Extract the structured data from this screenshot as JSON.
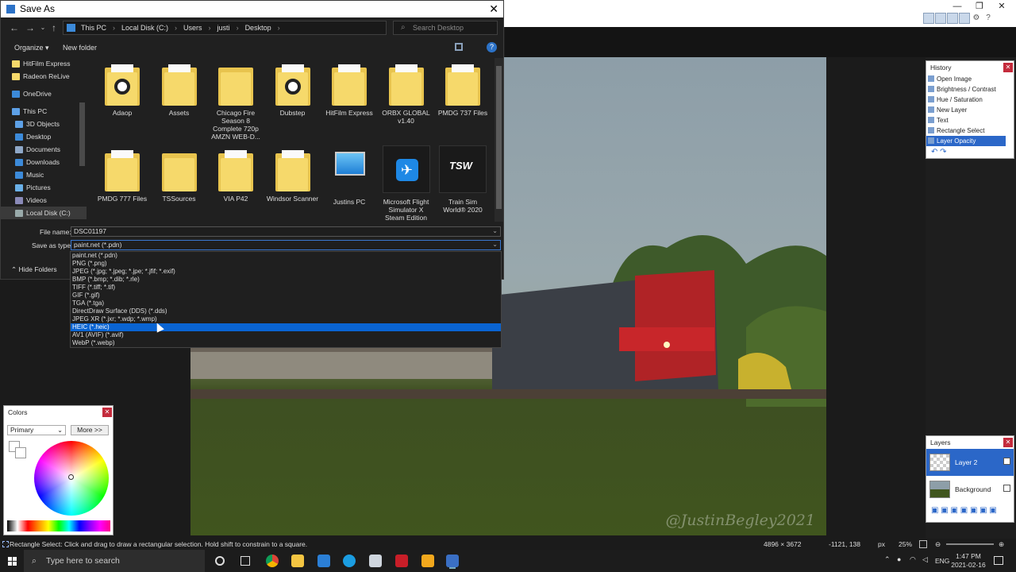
{
  "dialog": {
    "title": "Save As",
    "breadcrumb": [
      "This PC",
      "Local Disk (C:)",
      "Users",
      "justi",
      "Desktop"
    ],
    "search_placeholder": "Search Desktop",
    "organize_label": "Organize ▾",
    "new_folder_label": "New folder",
    "nav_items": [
      {
        "label": "HitFilm Express",
        "color": "#f6d96b"
      },
      {
        "label": "Radeon ReLive",
        "color": "#f6d96b"
      },
      {
        "label": "",
        "color": ""
      },
      {
        "label": "OneDrive",
        "color": "#3c8ad9"
      },
      {
        "label": "",
        "color": ""
      },
      {
        "label": "This PC",
        "color": "#5da0e6"
      },
      {
        "label": "3D Objects",
        "color": "#5da0e6"
      },
      {
        "label": "Desktop",
        "color": "#3c8ad9"
      },
      {
        "label": "Documents",
        "color": "#8fa8c8"
      },
      {
        "label": "Downloads",
        "color": "#3c8ad9"
      },
      {
        "label": "Music",
        "color": "#3c8ad9"
      },
      {
        "label": "Pictures",
        "color": "#6ab0e8"
      },
      {
        "label": "Videos",
        "color": "#8a8ab8"
      },
      {
        "label": "Local Disk (C:)",
        "color": "#9aa"
      }
    ],
    "files": [
      {
        "label": "Adaop",
        "kind": "doc-folder"
      },
      {
        "label": "Assets",
        "kind": "paper-folder"
      },
      {
        "label": "Chicago Fire Season 8 Complete 720p AMZN WEB-D...",
        "kind": "folder"
      },
      {
        "label": "Dubstep",
        "kind": "doc-folder"
      },
      {
        "label": "HitFilm Express",
        "kind": "paper-folder"
      },
      {
        "label": "ORBX GLOBAL v1.40",
        "kind": "paper-folder"
      },
      {
        "label": "PMDG 737 Files",
        "kind": "paper-folder"
      },
      {
        "label": "PMDG 777 Files",
        "kind": "paper-folder"
      },
      {
        "label": "TSSources",
        "kind": "folder"
      },
      {
        "label": "VIA P42",
        "kind": "paper-folder"
      },
      {
        "label": "Windsor Scanner",
        "kind": "paper-folder"
      },
      {
        "label": "Justins PC",
        "kind": "pc"
      },
      {
        "label": "Microsoft Flight Simulator X Steam Edition",
        "kind": "fsx"
      },
      {
        "label": "Train Sim World® 2020",
        "kind": "tsw"
      }
    ],
    "tsw_logo_text": "TSW",
    "file_name_label": "File name:",
    "file_name_value": "DSC01197",
    "save_type_label": "Save as type:",
    "save_type_value": "paint.net (*.pdn)",
    "hide_folders_label": "Hide Folders",
    "type_options": [
      "paint.net (*.pdn)",
      "PNG (*.png)",
      "JPEG (*.jpg; *.jpeg; *.jpe; *.jfif; *.exif)",
      "BMP (*.bmp; *.dib; *.rle)",
      "TIFF (*.tiff; *.tif)",
      "GIF (*.gif)",
      "TGA (*.tga)",
      "DirectDraw Surface (DDS) (*.dds)",
      "JPEG XR (*.jxr; *.wdp; *.wmp)",
      "HEIC (*.heic)",
      "AV1 (AVIF) (*.avif)",
      "WebP (*.webp)"
    ],
    "selected_option": "HEIC (*.heic)"
  },
  "history": {
    "title": "History",
    "items": [
      "Open Image",
      "Brightness / Contrast",
      "Hue / Saturation",
      "New Layer",
      "Text",
      "Rectangle Select",
      "Layer Opacity"
    ],
    "selected": "Layer Opacity"
  },
  "colors": {
    "title": "Colors",
    "mode": "Primary",
    "more_label": "More >>"
  },
  "layers": {
    "title": "Layers",
    "items": [
      "Layer 2",
      "Background"
    ],
    "selected": "Layer 2"
  },
  "canvas": {
    "watermark": "@JustinBegley2021"
  },
  "status": {
    "hint": "Rectangle Select: Click and drag to draw a rectangular selection. Hold shift to constrain to a square.",
    "image_size": "4896 × 3672",
    "cursor_pos": "-1121, 138",
    "units": "px",
    "zoom": "25%"
  },
  "taskbar": {
    "search_placeholder": "Type here to search",
    "language": "ENG",
    "time": "1:47 PM",
    "date": "2021-02-16"
  },
  "colors_theme": {
    "accent": "#0a64d2",
    "selection": "#2b67c8",
    "close": "#c42b3c"
  }
}
